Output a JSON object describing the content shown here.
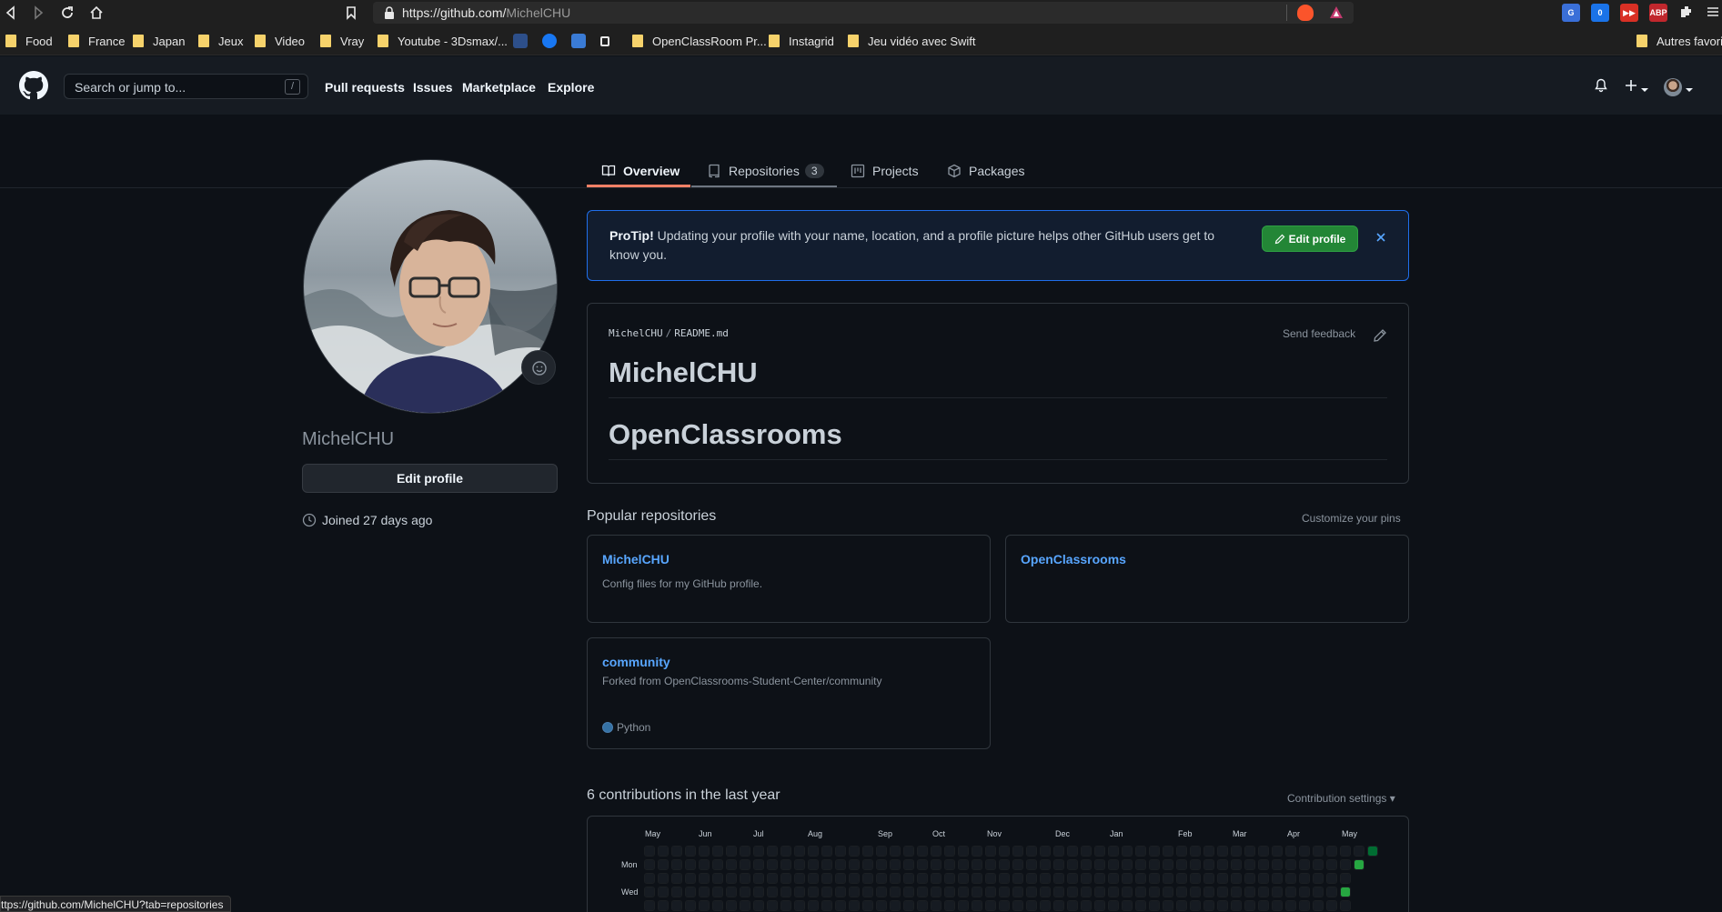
{
  "browser": {
    "url_main": "https://github.com/",
    "url_path": "MichelCHU",
    "bookmarks": [
      "Food",
      "France",
      "Japan",
      "Jeux",
      "Video",
      "Vray",
      "Youtube - 3Dsmax/...",
      "OpenClassRoom Pr...",
      "Instagrid",
      "Jeu vidéo avec Swift",
      "Autres favoris"
    ],
    "status_url": "ttps://github.com/MichelCHU?tab=repositories"
  },
  "header": {
    "search_placeholder": "Search or jump to...",
    "slash": "/",
    "nav": [
      "Pull requests",
      "Issues",
      "Marketplace",
      "Explore"
    ]
  },
  "tabs": {
    "overview": "Overview",
    "repositories": "Repositories",
    "repositories_count": "3",
    "projects": "Projects",
    "packages": "Packages"
  },
  "profile": {
    "username": "MichelCHU",
    "edit_label": "Edit profile",
    "joined": "Joined 27 days ago"
  },
  "protip": {
    "bold": "ProTip!",
    "text": " Updating your profile with your name, location, and a profile picture helps other GitHub users get to know you.",
    "button": "Edit profile"
  },
  "readme": {
    "owner": "MichelCHU",
    "file": "README.md",
    "feedback": "Send feedback",
    "heading1": "MichelCHU",
    "heading2": "OpenClassrooms"
  },
  "popular": {
    "title": "Popular repositories",
    "customize": "Customize your pins",
    "repos": [
      {
        "name": "MichelCHU",
        "desc": "Config files for my GitHub profile."
      },
      {
        "name": "OpenClassrooms",
        "desc": ""
      },
      {
        "name": "community",
        "desc": "Forked from OpenClassrooms-Student-Center/community",
        "lang": "Python"
      }
    ]
  },
  "contributions": {
    "title": "6 contributions in the last year",
    "settings": "Contribution settings",
    "months": [
      "May",
      "Jun",
      "Jul",
      "Aug",
      "Sep",
      "Oct",
      "Nov",
      "Dec",
      "Jan",
      "Feb",
      "Mar",
      "Apr",
      "May"
    ],
    "days": [
      "Mon",
      "Wed"
    ]
  },
  "colors": {
    "accent_green": "#238636",
    "link_blue": "#58a6ff",
    "tab_underline": "#f78166",
    "contrib_light": "#26a641",
    "contrib_dark": "#006d32"
  }
}
